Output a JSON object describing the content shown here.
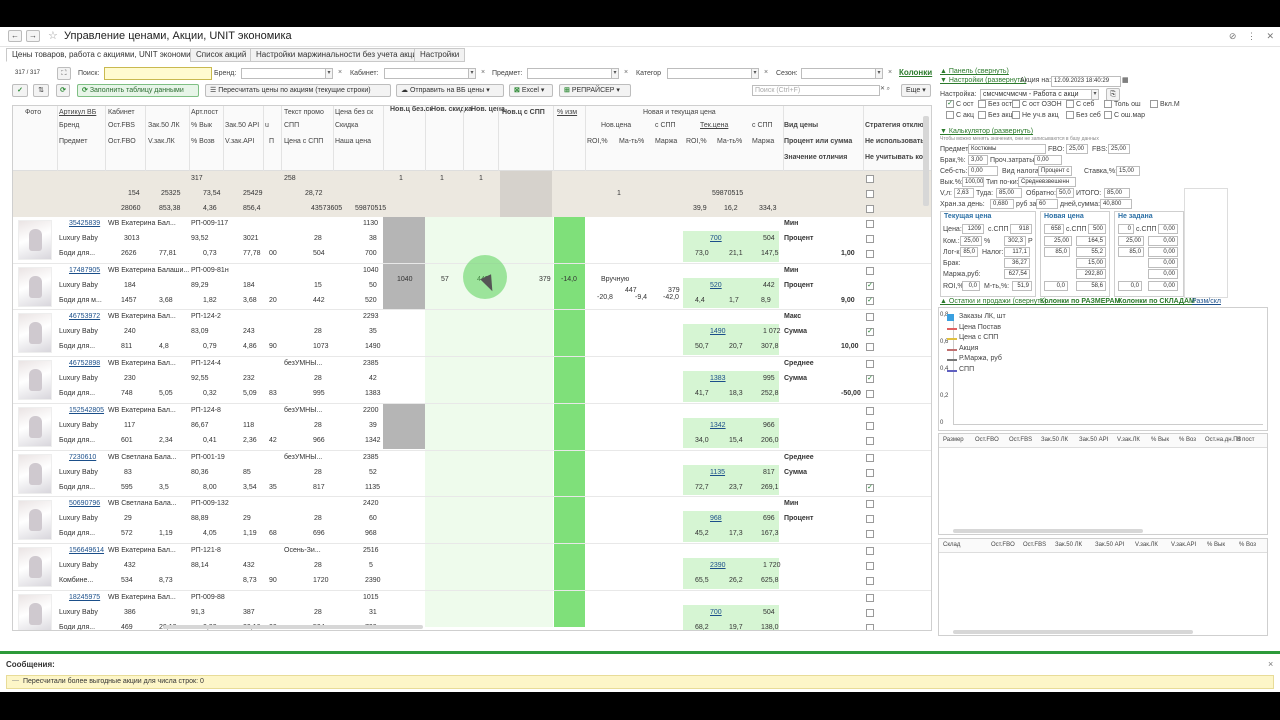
{
  "window": {
    "title": "Управление ценами, Акции, UNIT экономика",
    "star": "☆",
    "back": "←",
    "forward": "→",
    "icons": [
      "⊘",
      "⋮",
      "✕"
    ]
  },
  "tabs": [
    {
      "label": "Цены товаров, работа с акциями, UNIT экономика",
      "active": true
    },
    {
      "label": "Список акций"
    },
    {
      "label": "Настройки маржинальности без учета акций"
    },
    {
      "label": "Настройки"
    }
  ],
  "filters": {
    "counter": "317 / 317",
    "search_label": "Поиск:",
    "search_value": "",
    "brand_label": "Бренд:",
    "cabinet_label": "Кабинет:",
    "subject_label": "Предмет:",
    "category_label": "Категор",
    "season_label": "Сезон:",
    "columns_link": "Колонки"
  },
  "toolbar": {
    "fill_label": "Заполнить таблицу данными",
    "recalc_label": "Пересчитать цены по акциям (текущие строки)",
    "send_label": "Отправить на ВБ цены",
    "excel_label": "Excel",
    "pricer_label": "РЕПРАЙСЕР",
    "search_placeholder": "Поиск (Ctrl+F)",
    "more_label": "Еще"
  },
  "grid": {
    "headers": {
      "foto": "Фото",
      "article_wb": "Артикул ВБ",
      "cabinet": "Кабинет",
      "art_post": "Арт.пост",
      "promo_text": "Текст промо",
      "price_no_disc": "Цена без ск",
      "new_ts": "Нов.ц без.ск",
      "new_disc": "Нов. скидка",
      "new_price": "Нов. цена",
      "new_spp": "Нов.ц с СПП",
      "pct_change": "% изм",
      "new_current_group": "Новая и текущая цена",
      "price_type": "Вид цены",
      "strategy": "Стратегия отклю",
      "brand": "Бренд",
      "ost_fbs": "Ост.FBS",
      "zak50lk": "Зак.50 ЛК",
      "pct_out": "% Вык",
      "zak50api": "Зак.50 API",
      "spp": "СПП",
      "discount": "Скидка",
      "new_price2": "Нов.цена",
      "with_spp": "с СПП",
      "cur_price": "Тек.цена",
      "with_spp2": "с СПП",
      "percent_or_sum": "Процент или сумма",
      "not_use": "Не использовать",
      "subject": "Предмет",
      "ost_fbo": "Ост.FBO",
      "vzak_lk": "V.зак.ЛК",
      "pct_ret": "% Возв",
      "vzak_api": "V.зак.API",
      "price_with_spp": "Цена с СПП",
      "our_price": "Наша цена",
      "roi": "ROI,%",
      "margin_rub": "Ма-ть%",
      "margin": "Маржа",
      "roi2": "ROI,%",
      "margin2": "Ма-ть%",
      "margin3": "Маржа",
      "diff_value": "Значение отличия",
      "not_account": "Не учитывать ко",
      "col_u": "u",
      "col_p": "П"
    },
    "totals": [
      {
        "cab": "",
        "art": "317",
        "promo": "258",
        "n1": "1",
        "n2": "1",
        "n3": "1"
      },
      {
        "cab": "154",
        "zk": "25325",
        "vyk": "73,54",
        "api": "25429",
        "spp": "28,72",
        "np": "1",
        "cp": "59870515"
      },
      {
        "cab": "28060",
        "zk": "853,38",
        "vyk": "4,36",
        "api": "856,4",
        "spp": "43573605",
        "disc": "59870515",
        "roi": "39,9",
        "mar": "16,2",
        "m": "334,3"
      }
    ],
    "rows": [
      {
        "art": "35425839",
        "cab": "WB Екатерина Бал...",
        "post": "РП-009-117",
        "promo": "",
        "pns": "1130",
        "brand": "Luxury Baby",
        "fbs": "3013",
        "zlk": "93,52",
        "zapi": "3021",
        "spp": "28",
        "sk": "38",
        "subj": "Боди для...",
        "fbo": "2626",
        "vlk": "77,81",
        "voz": "0,73",
        "vapi": "77,78",
        "pc": "00",
        "cspp": "504",
        "our": "700",
        "cur": "700",
        "cspp2": "504",
        "roi": "73,0",
        "mt": "21,1",
        "mg": "147,5",
        "type": "Мин",
        "ps": "Процент",
        "val": "1,00",
        "c1": false,
        "c2": false,
        "c3": false
      },
      {
        "art": "17487905",
        "cab": "WB Екатерина Балаши...",
        "post": "РП-009-81н",
        "promo": "",
        "pns": "1040",
        "brand": "Luxury Baby",
        "fbs": "184",
        "zlk": "89,29",
        "zapi": "184",
        "spp": "15",
        "sk": "50",
        "subj": "Боди для м...",
        "fbo": "1457",
        "vlk": "3,68",
        "voz": "1,82",
        "vapi": "3,68",
        "pc": "20",
        "cspp": "442",
        "our": "520",
        "nts": "1040",
        "nsk": "57",
        "npr": "447",
        "nspp": "379",
        "pct": "-14,0",
        "mode": "Вручную",
        "np": "447",
        "nsp": "379",
        "nroi": "-20,8",
        "nmt": "-9,4",
        "nmg": "-42,0",
        "cur": "520",
        "cspp2": "442",
        "roi": "4,4",
        "mt": "1,7",
        "mg": "8,9",
        "type": "Мин",
        "ps": "Процент",
        "val": "9,00",
        "c1": false,
        "c2": true,
        "c3": true
      },
      {
        "art": "46753972",
        "cab": "WB Екатерина Бал...",
        "post": "РП-124-2",
        "promo": "",
        "pns": "2293",
        "brand": "Luxury Baby",
        "fbs": "240",
        "zlk": "83,09",
        "zapi": "243",
        "spp": "28",
        "sk": "35",
        "subj": "Боди для...",
        "fbo": "811",
        "vlk": "4,8",
        "voz": "0,79",
        "vapi": "4,86",
        "pc": "90",
        "cspp": "1073",
        "our": "1490",
        "cur": "1490",
        "cspp2": "1 072",
        "roi": "50,7",
        "mt": "20,7",
        "mg": "307,8",
        "type": "Макс",
        "ps": "Сумма",
        "val": "10,00",
        "c1": false,
        "c2": true,
        "c3": false
      },
      {
        "art": "46752898",
        "cab": "WB Екатерина Бал...",
        "post": "РП-124-4",
        "promo": "безУМНЫ...",
        "pns": "2385",
        "brand": "Luxury Baby",
        "fbs": "230",
        "zlk": "92,55",
        "zapi": "232",
        "spp": "28",
        "sk": "42",
        "subj": "Боди для...",
        "fbo": "748",
        "vlk": "5,05",
        "voz": "0,32",
        "vapi": "5,09",
        "pc": "83",
        "cspp": "995",
        "our": "1383",
        "cur": "1383",
        "cspp2": "995",
        "roi": "41,7",
        "mt": "18,3",
        "mg": "252,8",
        "type": "Среднее",
        "ps": "Сумма",
        "val": "-50,00",
        "c1": false,
        "c2": true,
        "c3": false
      },
      {
        "art": "152542805",
        "cab": "WB Екатерина Бал...",
        "post": "РП-124-8",
        "promo": "безУМНЫ...",
        "pns": "2200",
        "brand": "Luxury Baby",
        "fbs": "117",
        "zlk": "86,67",
        "zapi": "118",
        "spp": "28",
        "sk": "39",
        "subj": "Боди для...",
        "fbo": "601",
        "vlk": "2,34",
        "voz": "0,41",
        "vapi": "2,36",
        "pc": "42",
        "cspp": "966",
        "our": "1342",
        "cur": "1342",
        "cspp2": "966",
        "roi": "34,0",
        "mt": "15,4",
        "mg": "206,0",
        "type": "",
        "ps": "",
        "val": "",
        "c1": false,
        "c2": false,
        "c3": false
      },
      {
        "art": "7230610",
        "cab": "WB Светлана Бала...",
        "post": "РП-001-19",
        "promo": "безУМНЫ...",
        "pns": "2385",
        "brand": "Luxury Baby",
        "fbs": "83",
        "zlk": "80,36",
        "zapi": "85",
        "spp": "28",
        "sk": "52",
        "subj": "Боди для...",
        "fbo": "595",
        "vlk": "3,5",
        "voz": "8,00",
        "vapi": "3,54",
        "pc": "35",
        "cspp": "817",
        "our": "1135",
        "cur": "1135",
        "cspp2": "817",
        "roi": "72,7",
        "mt": "23,7",
        "mg": "269,1",
        "type": "Среднее",
        "ps": "Сумма",
        "val": "",
        "c1": false,
        "c2": false,
        "c3": true
      },
      {
        "art": "50690796",
        "cab": "WB Светлана Бала...",
        "post": "РП-009-132",
        "promo": "",
        "pns": "2420",
        "brand": "Luxury Baby",
        "fbs": "29",
        "zlk": "88,89",
        "zapi": "29",
        "spp": "28",
        "sk": "60",
        "subj": "Боди для...",
        "fbo": "572",
        "vlk": "1,19",
        "voz": "4,05",
        "vapi": "1,19",
        "pc": "68",
        "cspp": "696",
        "our": "968",
        "cur": "968",
        "cspp2": "696",
        "roi": "45,2",
        "mt": "17,3",
        "mg": "167,3",
        "type": "Мин",
        "ps": "Процент",
        "val": "",
        "c1": false,
        "c2": false,
        "c3": false
      },
      {
        "art": "156649614",
        "cab": "WB Екатерина Бал...",
        "post": "РП-121-8",
        "promo": "Осень-Зи...",
        "pns": "2516",
        "brand": "Luxury Baby",
        "fbs": "432",
        "zlk": "88,14",
        "zapi": "432",
        "spp": "28",
        "sk": "5",
        "subj": "Комбине...",
        "fbo": "534",
        "vlk": "8,73",
        "voz": "",
        "vapi": "8,73",
        "pc": "90",
        "cspp": "1720",
        "our": "2390",
        "cur": "2390",
        "cspp2": "1 720",
        "roi": "65,5",
        "mt": "26,2",
        "mg": "625,8",
        "type": "",
        "ps": "",
        "val": "",
        "c1": false,
        "c2": false,
        "c3": false
      },
      {
        "art": "18245975",
        "cab": "WB Екатерина Бал...",
        "post": "РП-009-88",
        "promo": "",
        "pns": "1015",
        "brand": "Luxury Baby",
        "fbs": "386",
        "zlk": "91,3",
        "zapi": "387",
        "spp": "28",
        "sk": "31",
        "subj": "Боди для...",
        "fbo": "469",
        "vlk": "20,12",
        "voz": "0,92",
        "vapi": "20,16",
        "pc": "00",
        "cspp": "504",
        "our": "700",
        "cur": "700",
        "cspp2": "504",
        "roi": "68,2",
        "mt": "19,7",
        "mg": "138,0",
        "type": "",
        "ps": "",
        "val": "",
        "c1": false,
        "c2": false,
        "c3": false
      }
    ]
  },
  "panel": {
    "panel_link": "▲ Панель (свернуть)",
    "settings_link": "▼ Настройки (развернуть)",
    "action_date_label": "Акция на:",
    "action_date": "12.09.2023 18:40:29",
    "setting_label": "Настройка:",
    "setting_value": "смсчмсчмсчм - Работа с акци",
    "checks": [
      "С ост",
      "Без ост",
      "С ост ОЗОН",
      "С себ",
      "Толь ош",
      "Вкл.М",
      "С акц",
      "Без акц",
      "Не уч.в акц",
      "Без себ",
      "С ош.мар"
    ],
    "calc_link": "▼ Калькулятор (развернуть)",
    "calc_note": "Чтобы можно менять значения, они не записываются в базу данных",
    "subject_label": "Предмет:",
    "subject_value": "Костюмы",
    "fbo_label": "FBO:",
    "fbo_value": "25,00",
    "fbs_label": "FBS:",
    "fbs_value": "25,00",
    "brak_label": "Брак,%:",
    "brak_value": "3,00",
    "proch_label": "Проч.затраты:",
    "proch_value": "0,00",
    "seb_label": "Себ-сть:",
    "seb_value": "0,00",
    "nalog_label": "Вид налога:",
    "nalog_value": "Процент с",
    "stavka_label": "Ставка,%:",
    "stavka_value": "15,00",
    "vyk_label": "Вык.%:",
    "vyk_value": "100,00",
    "tip_label": "Тип по-ки:",
    "tip_value": "Средневзвешенн",
    "vl_label": "V,л:",
    "vl_value": "2,63",
    "tuda_label": "Туда:",
    "tuda_value": "85,00",
    "obr_label": "Обратно:",
    "obr_value": "50,0",
    "itogo_label": "ИТОГО:",
    "itogo_value": "85,00",
    "hran_label": "Хран.за день:",
    "hran_value": "0,680",
    "rub_label": "руб за",
    "days_value": "60",
    "dsum_label": "дней,сумма:",
    "dsum_value": "40,800",
    "cur_title": "Текущая цена",
    "new_title": "Новая цена",
    "none_title": "Не задана",
    "cena_label": "Цена:",
    "cena_v": "1209",
    "sspp_label": "с.СПП",
    "sspp_v": "918",
    "n_cena": "658",
    "n_sspp": "500",
    "z_cena": "0",
    "z_sspp": "0,00",
    "kom_label": "Ком.:",
    "kom_v": "25,00",
    "pct": "%",
    "kom_rub": "302,3",
    "r": "Р",
    "n_kom": "25,00",
    "n_kom_rub": "164,5",
    "z_kom": "25,00",
    "z_kom_rub": "0,00",
    "log_label": "Лог-ка:",
    "log_v": "85,0",
    "nal_label": "Налог:",
    "nal_v": "117,1",
    "n_log": "85,0",
    "n_nal": "55,2",
    "z_log": "85,0",
    "z_nal": "0,00",
    "brak2_label": "Брак:",
    "brak2_v": "36,27",
    "n_brak": "15,00",
    "z_brak": "0,00",
    "marzh_label": "Маржа,руб:",
    "marzh_v": "627,54",
    "n_marzh": "292,80",
    "z_marzh": "0,00",
    "roi_label": "ROI,%:",
    "roi_v": "0,0",
    "mt_label": "М-ть,%:",
    "mt_v": "51,9",
    "n_roi": "0,0",
    "n_mt": "58,6",
    "z_roi": "0,0",
    "z_mt": "0,00",
    "stock_link": "▲ Остатки и продажи (свернуть)",
    "sizes_link": "Колонки по РАЗМЕРАМ",
    "wh_link": "Колонки по СКЛАДАМ",
    "razm_link": "Разм/скл",
    "legend": [
      "Заказы ЛК, шт",
      "Цена Постав",
      "Цена с СПП",
      "Акция",
      "Р.Маржа, руб",
      "СПП"
    ],
    "yticks": [
      "0,8",
      "0,6",
      "0,4",
      "0,2",
      "0"
    ],
    "size_headers": [
      "Размер",
      "Ост.FBO",
      "Ост.FBS",
      "Зак.50 ЛК",
      "Зак.50 API",
      "V.зак.ЛК",
      "% Вык",
      "% Воз",
      "Ост.на.дн.ПЗ",
      "К пост"
    ],
    "wh_headers": [
      "Склад",
      "Ост.FBO",
      "Ост.FBS",
      "Зак.50 ЛК",
      "Зак.50 API",
      "V.зак.ЛК",
      "V.зак.API",
      "% Вык",
      "% Воз"
    ]
  },
  "messages": {
    "title": "Сообщения:",
    "text": "Пересчитали более выгодные акции для числа строк: 0",
    "close": "×"
  },
  "colors": {
    "accent_green": "#47a64e",
    "light_green": "#d6f5d3",
    "bright_green": "#7fe07a",
    "link_green": "#2b7a2b",
    "totals_bg": "#ece8e0",
    "grey_cell": "#b5b5b5",
    "msg_yellow": "#fdf6c8"
  }
}
